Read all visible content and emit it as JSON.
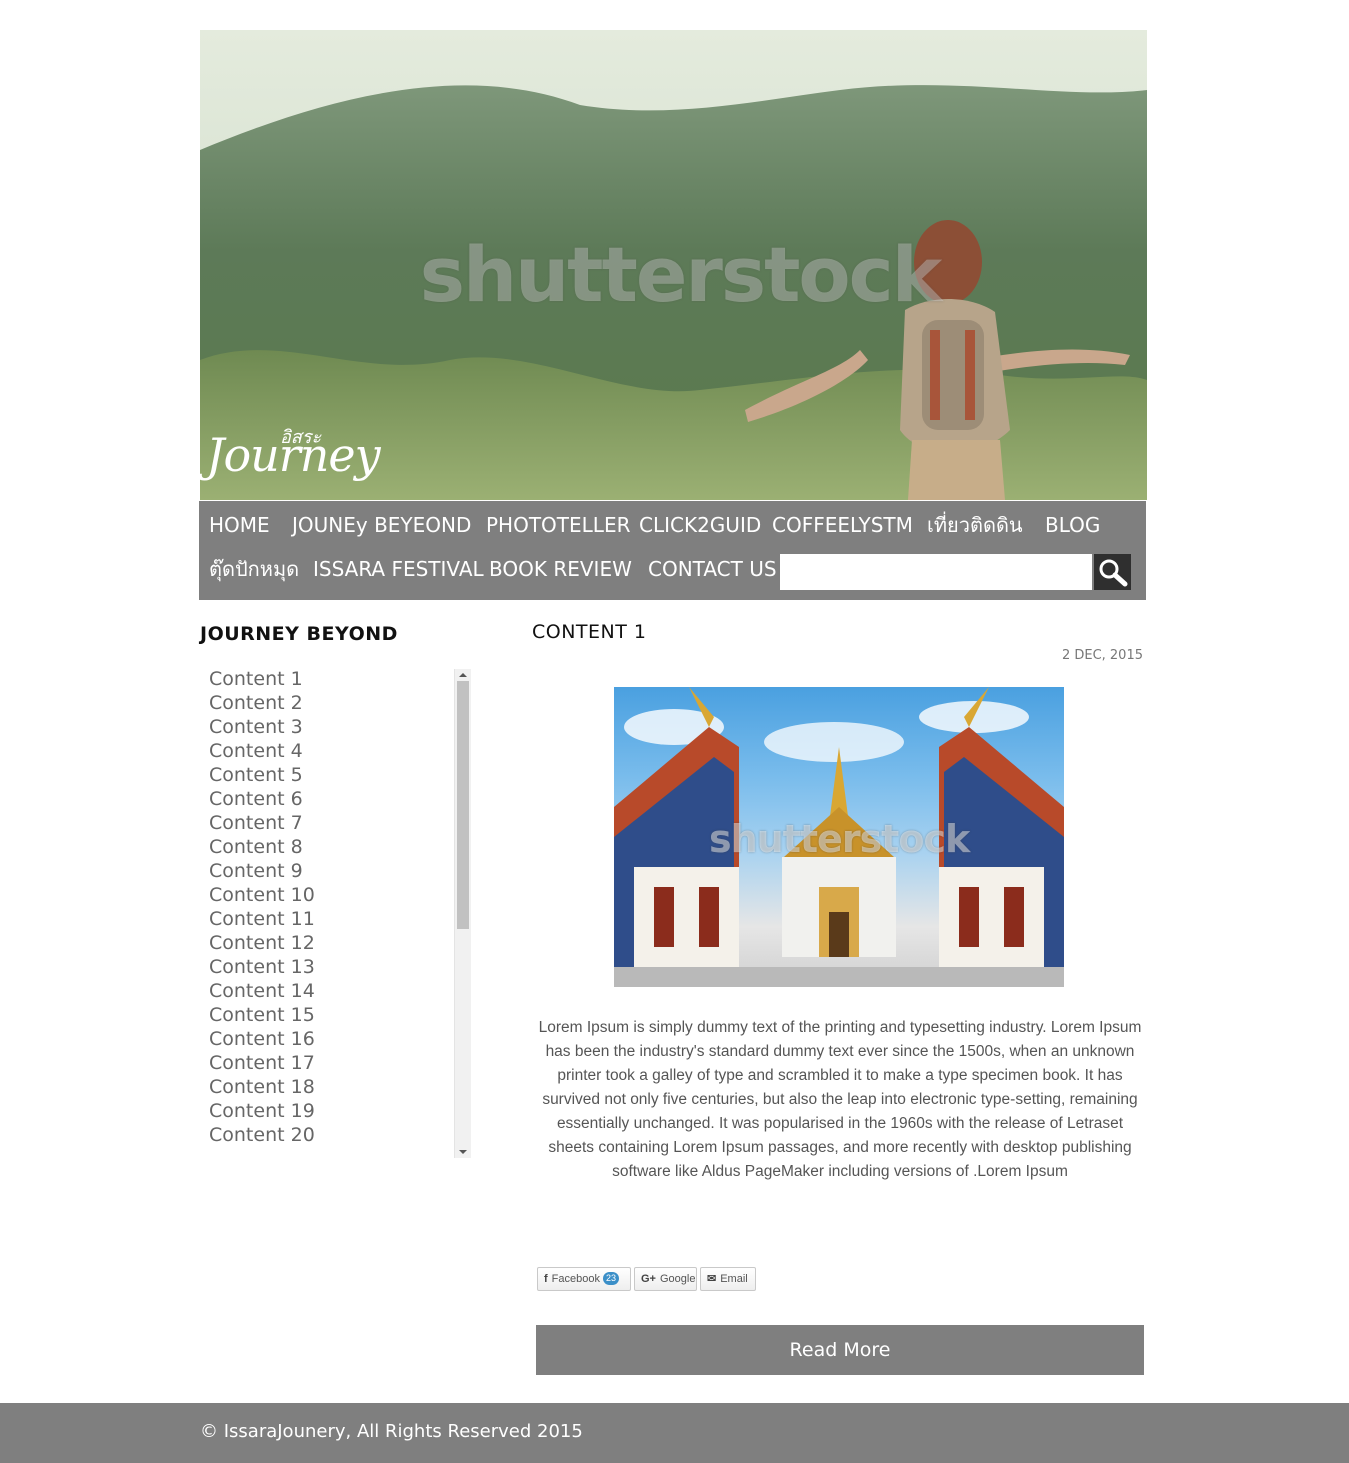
{
  "hero": {
    "watermark": "shutterstock",
    "logo_thai": "อิสระ",
    "logo_main": "Journey"
  },
  "nav": {
    "row1": [
      "HOME",
      "JOUNEy BEYEOND",
      "PHOTOTELLER",
      "CLICK2GUID",
      "COFFEELYSTM",
      "เที่ยวติดดิน",
      "BLOG"
    ],
    "row2": [
      "ตุ๊ดปักหมุด",
      "ISSARA FESTIVAL",
      "BOOK REVIEW",
      "CONTACT US"
    ],
    "search_value": "",
    "search_icon": "magnifier-icon"
  },
  "sidebar": {
    "title": "JOURNEY BEYOND",
    "items": [
      "Content 1",
      "Content 2",
      "Content 3",
      "Content 4",
      "Content 5",
      "Content 6",
      "Content 7",
      "Content 8",
      "Content 9",
      "Content 10",
      "Content 11",
      "Content 12",
      "Content 13",
      "Content 14",
      "Content 15",
      "Content 16",
      "Content 17",
      "Content 18",
      "Content 19",
      "Content 20"
    ]
  },
  "main": {
    "title": "CONTENT 1",
    "date": "2 DEC, 2015",
    "image_watermark": "shutterstock",
    "body": "Lorem Ipsum is simply dummy text of the printing and typesetting industry. Lorem Ipsum has been the industry's standard dummy text ever since the 1500s, when an unknown printer took a galley of type and scrambled it to make a type specimen book. It has survived not only five centuries, but also the leap into electronic type-setting, remaining essentially unchanged. It was popularised in the 1960s with the release of Letraset sheets containing Lorem Ipsum passages, and more recently with desktop publishing software like Aldus PageMaker including versions of .Lorem Ipsum",
    "share": {
      "facebook_label": "Facebook",
      "facebook_count": "23",
      "google_label": "Google",
      "email_label": "Email"
    },
    "read_more": "Read More"
  },
  "footer": {
    "text": "© IssaraJounery, All Rights Reserved 2015"
  },
  "colors": {
    "nav_bg": "#7f7f7f",
    "footer_bg": "#7f7f7f",
    "read_more_bg": "#7f7f7f",
    "search_btn_bg": "#2f2f2f"
  }
}
